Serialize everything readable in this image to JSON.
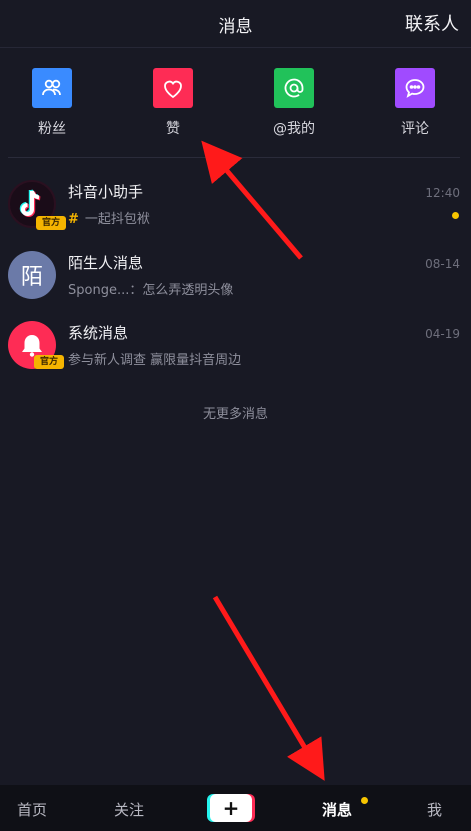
{
  "header": {
    "title": "消息",
    "contacts": "联系人"
  },
  "actions": [
    {
      "label": "粉丝",
      "icon": "fans-icon",
      "color": "#3a8bff"
    },
    {
      "label": "赞",
      "icon": "heart-icon",
      "color": "#fe2c55"
    },
    {
      "label": "@我的",
      "icon": "at-icon",
      "color": "#21c25a"
    },
    {
      "label": "评论",
      "icon": "comment-icon",
      "color": "#a04bff"
    }
  ],
  "messages": [
    {
      "title": "抖音小助手",
      "hash": "#",
      "subtitle": "一起抖包袱",
      "time": "12:40",
      "badge": "官方",
      "unread": true
    },
    {
      "title": "陌生人消息",
      "avatar_text": "陌",
      "subtitle": "Sponge...：怎么弄透明头像",
      "time": "08-14"
    },
    {
      "title": "系统消息",
      "subtitle": "参与新人调查 赢限量抖音周边",
      "time": "04-19",
      "badge": "官方"
    }
  ],
  "no_more": "无更多消息",
  "bottom_nav": {
    "home": "首页",
    "follow": "关注",
    "create": "+",
    "messages": "消息",
    "me": "我"
  },
  "colors": {
    "background": "#181924",
    "accent_yellow": "#f7c500",
    "arrow": "#ff1a1a"
  }
}
